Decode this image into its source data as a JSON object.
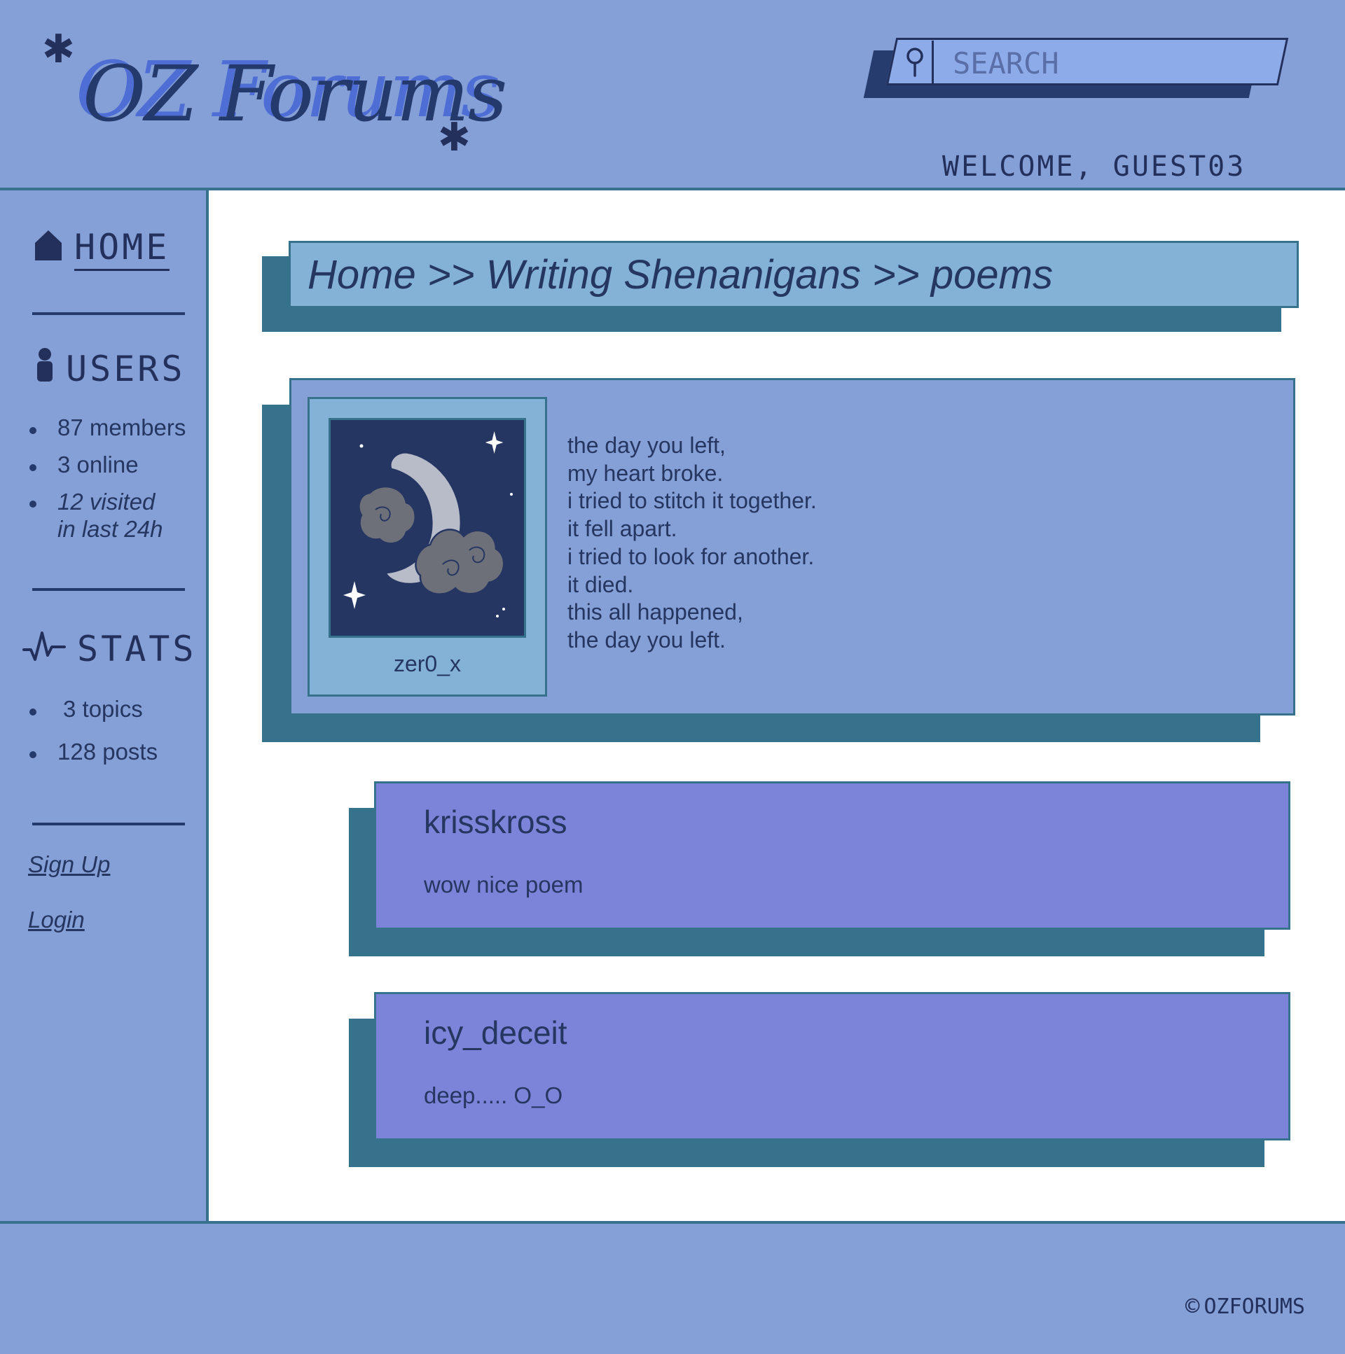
{
  "header": {
    "logo": "OZ Forums",
    "search": {
      "placeholder": "SEARCH"
    },
    "welcome": "WELCOME, GUEST03"
  },
  "sidebar": {
    "home_label": "HOME",
    "users": {
      "heading": "USERS",
      "items": [
        "87 members",
        "3 online"
      ],
      "visited_line1": "12 visited",
      "visited_line2": "in last 24h"
    },
    "stats": {
      "heading": "STATS",
      "items": [
        "3 topics",
        "128 posts"
      ]
    },
    "signup_label": "Sign Up",
    "login_label": "Login"
  },
  "breadcrumb": "Home >> Writing Shenanigans >> poems",
  "post": {
    "author": "zer0_x",
    "lines": [
      "the day you left,",
      "my heart broke.",
      "i tried to stitch it together.",
      "it fell apart.",
      "i tried to look for another.",
      "it died.",
      "this all happened,",
      "the day you left."
    ]
  },
  "replies": [
    {
      "author": "krisskross",
      "text": "wow nice poem"
    },
    {
      "author": "icy_deceit",
      "text": "deep..... O_O"
    }
  ],
  "footer": {
    "copyright_symbol": "©",
    "copyright_text": "OZFORUMS"
  }
}
